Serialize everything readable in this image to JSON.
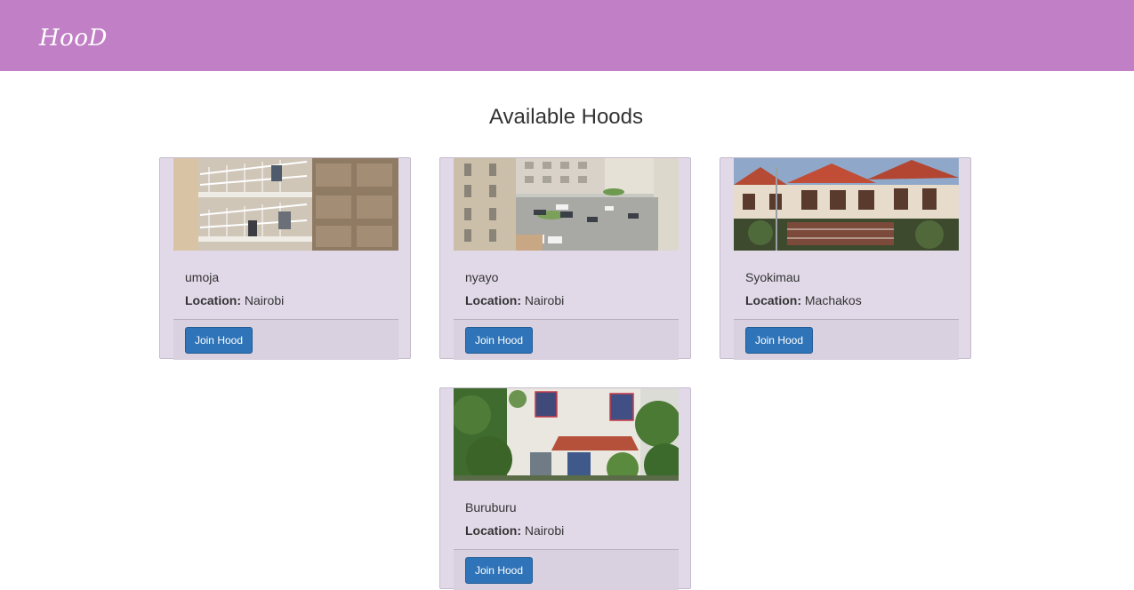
{
  "navbar": {
    "brand": "HooD",
    "color": "#c17fc5"
  },
  "page": {
    "title": "Available Hoods"
  },
  "hoods": [
    {
      "name": "umoja",
      "location_label": "Location:",
      "location": "Nairobi",
      "button_label": "Join Hood"
    },
    {
      "name": "nyayo",
      "location_label": "Location:",
      "location": "Nairobi",
      "button_label": "Join Hood"
    },
    {
      "name": "Syokimau",
      "location_label": "Location:",
      "location": "Machakos",
      "button_label": "Join Hood"
    },
    {
      "name": "Buruburu",
      "location_label": "Location:",
      "location": "Nairobi",
      "button_label": "Join Hood"
    }
  ],
  "colors": {
    "card_bg": "#e1d9e8",
    "button_bg": "#2f74b8"
  }
}
